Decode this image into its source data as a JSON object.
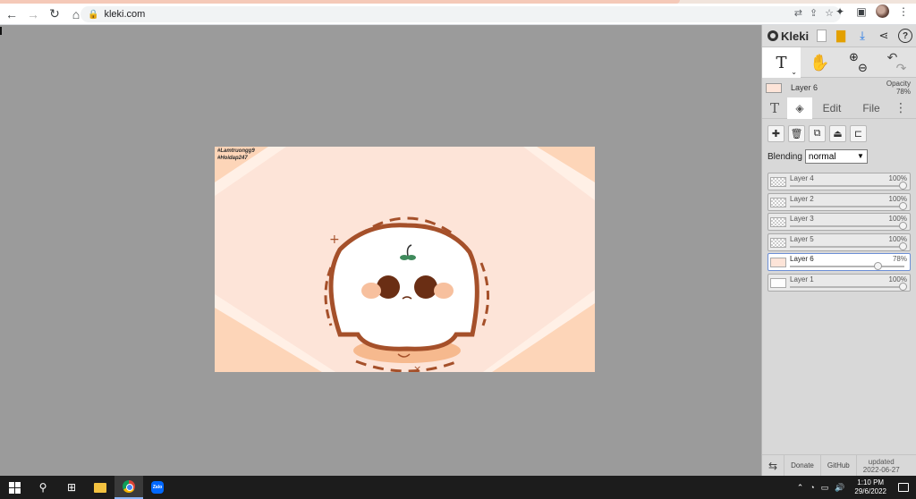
{
  "browser": {
    "url": "kleki.com",
    "nav": {
      "back": "←",
      "forward": "→",
      "reload": "↻",
      "home": "⌂"
    },
    "icons": [
      "translate-icon",
      "share-icon",
      "star-icon",
      "extensions-icon",
      "sidepanel-icon",
      "profile-avatar",
      "menu-icon"
    ]
  },
  "canvas": {
    "watermark_line1": "#Lamtruongg9",
    "watermark_line2": "#Hoidap247",
    "colors": {
      "background": "#fde4d8",
      "light_bands": "#fff0e6",
      "dark_bands": "#fdd5b8",
      "outline": "#a5502a",
      "face": "#ffffff",
      "eyes": "#6a2e14",
      "cheeks": "#f7c09e"
    }
  },
  "panel": {
    "brand": "Kleki",
    "current_layer": {
      "name": "Layer 6",
      "opacity_label": "Opacity",
      "opacity_value": "78%"
    },
    "tabs": {
      "edit": "Edit",
      "file": "File"
    },
    "blending_label": "Blending",
    "blending_value": "normal",
    "layers": [
      {
        "name": "Layer 4",
        "opacity": "100%",
        "level": 1.0,
        "thumb": "check",
        "selected": false
      },
      {
        "name": "Layer 2",
        "opacity": "100%",
        "level": 1.0,
        "thumb": "check",
        "selected": false
      },
      {
        "name": "Layer 3",
        "opacity": "100%",
        "level": 1.0,
        "thumb": "check",
        "selected": false
      },
      {
        "name": "Layer 5",
        "opacity": "100%",
        "level": 1.0,
        "thumb": "check",
        "selected": false
      },
      {
        "name": "Layer 6",
        "opacity": "78%",
        "level": 0.78,
        "thumb": "peach",
        "selected": true
      },
      {
        "name": "Layer 1",
        "opacity": "100%",
        "level": 1.0,
        "thumb": "solid",
        "selected": false
      }
    ],
    "footer": {
      "donate": "Donate",
      "github": "GitHub",
      "updated_label": "updated",
      "updated_date": "2022-06-27"
    }
  },
  "taskbar": {
    "time": "1:10 PM",
    "date": "29/6/2022",
    "zalo": "Zalo"
  }
}
